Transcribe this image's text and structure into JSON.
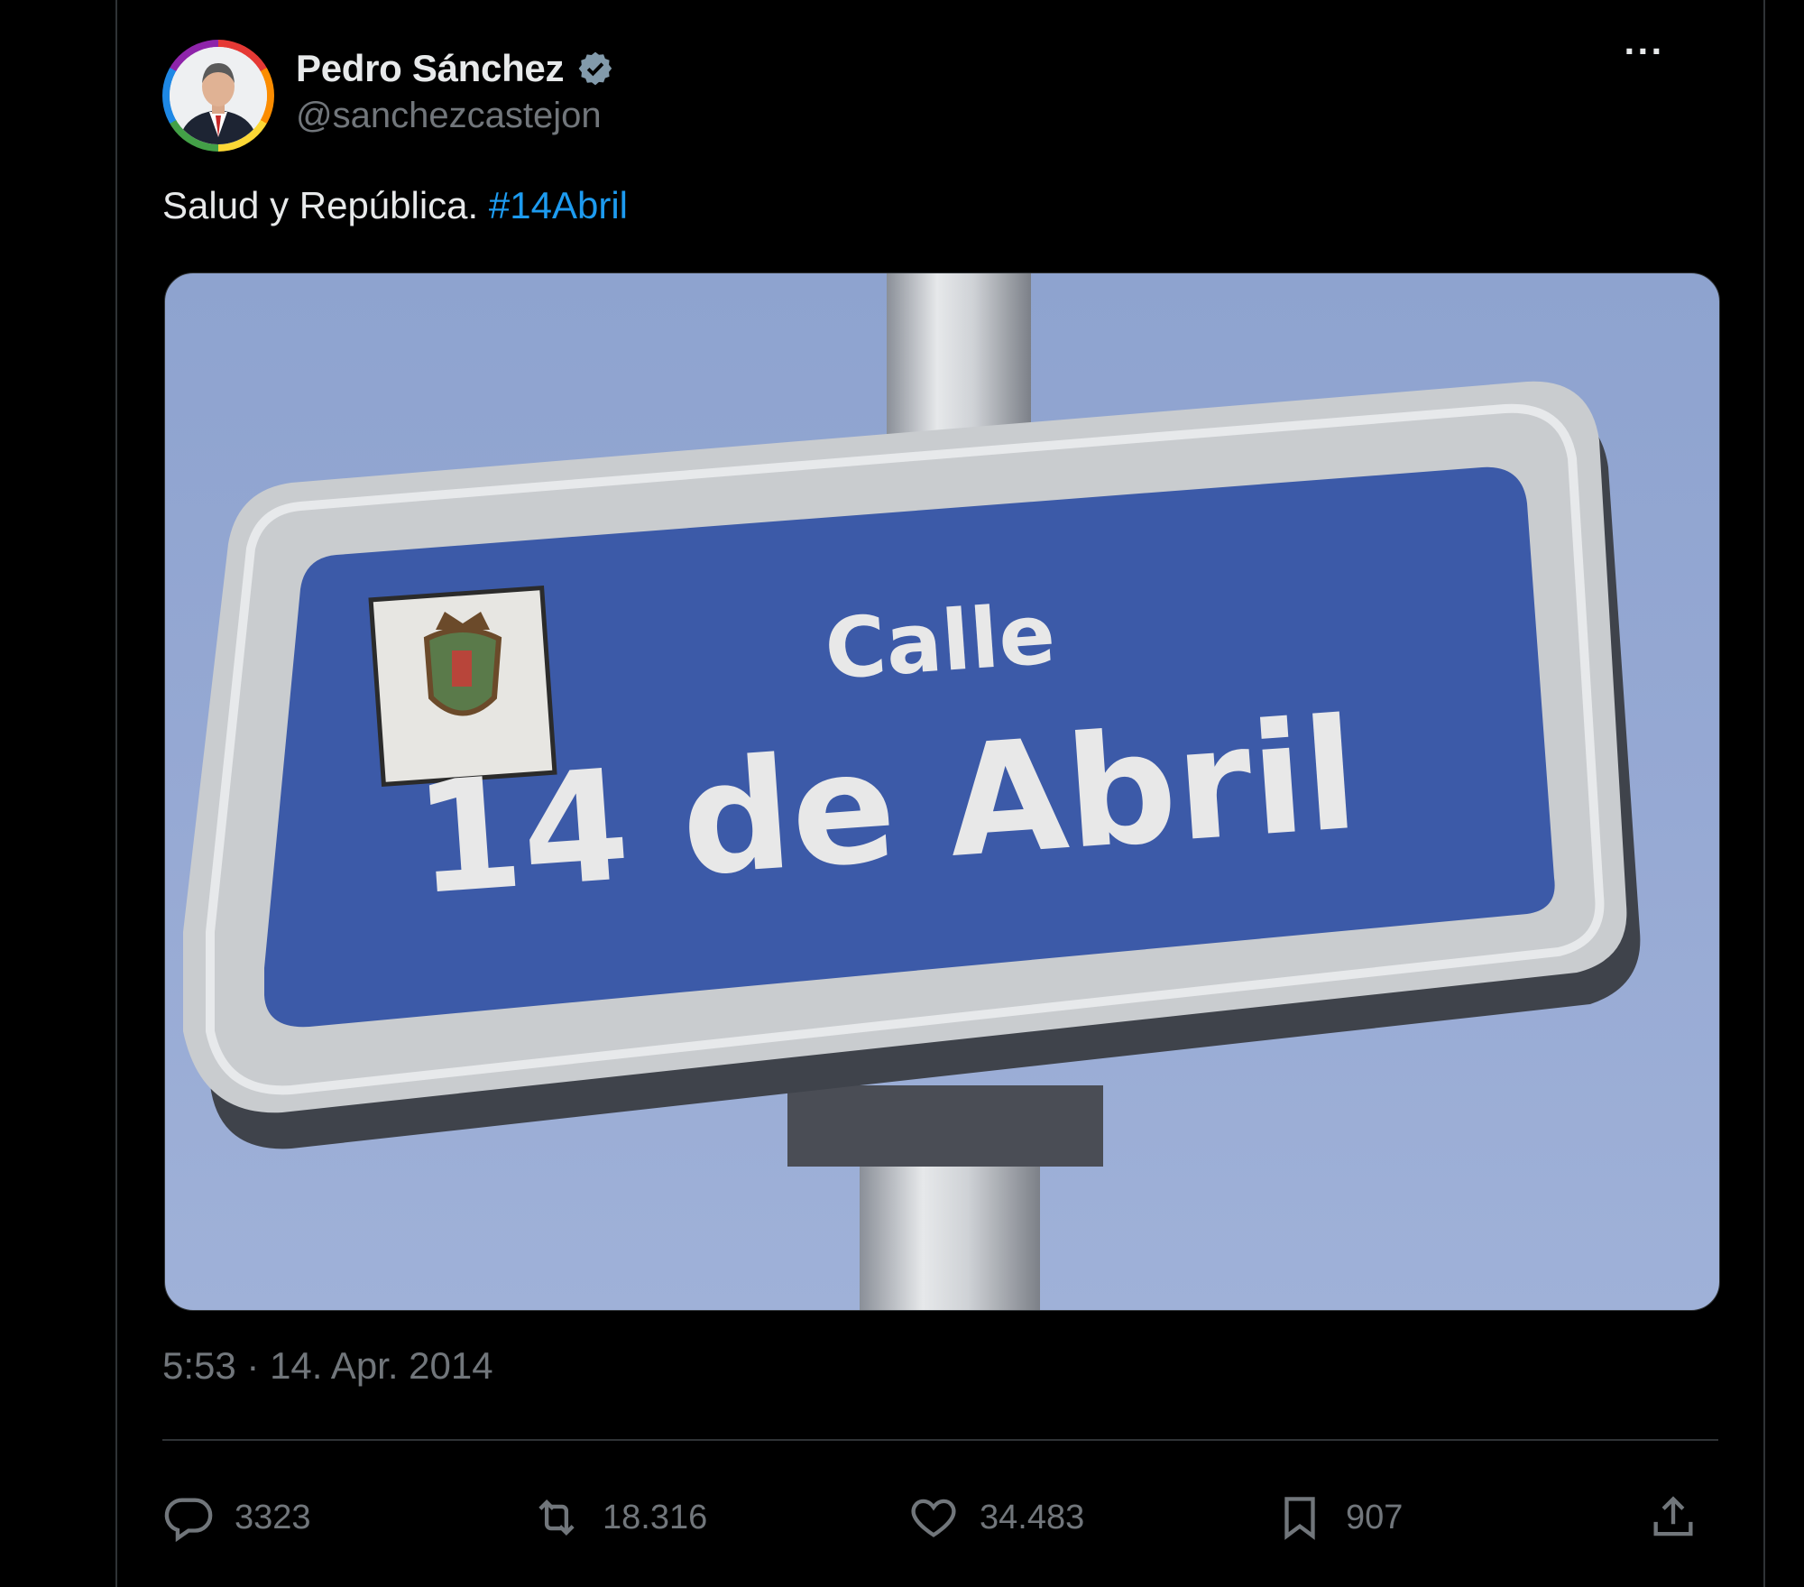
{
  "tweet": {
    "author_name": "Pedro Sánchez",
    "author_handle": "@sanchezcastejon",
    "more_label": "···",
    "text": "Salud y República.",
    "hashtag": "#14Abril",
    "timestamp": "5:53 · 14. Apr. 2014",
    "media": {
      "sign_line1": "Calle",
      "sign_line2": "14 de Abril"
    },
    "actions": {
      "replies": "3323",
      "reposts": "18.316",
      "likes": "34.483",
      "bookmarks": "907"
    }
  },
  "icons": [
    "verified-badge-icon",
    "more-icon",
    "reply-icon",
    "repost-icon",
    "like-icon",
    "bookmark-icon",
    "share-icon"
  ],
  "colors": {
    "background": "#000000",
    "text": "#e7e9ea",
    "muted": "#71767b",
    "accent": "#1d9bf0",
    "border": "#2f3336"
  }
}
